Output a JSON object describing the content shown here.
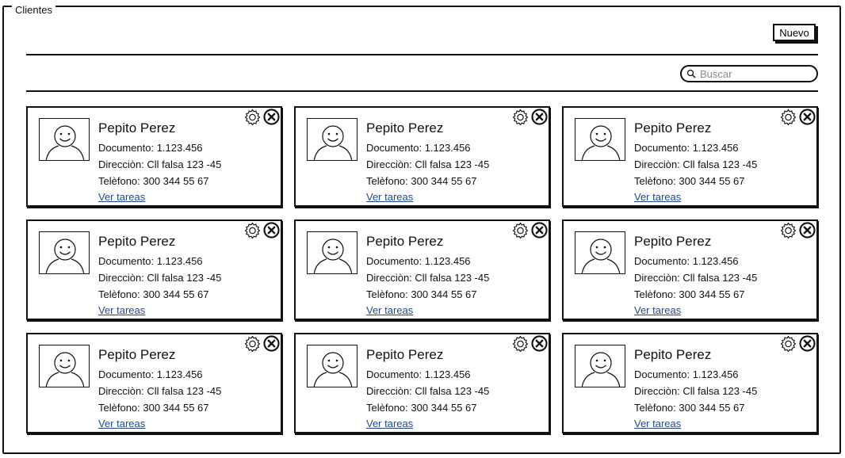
{
  "frame": {
    "title": "Clientes"
  },
  "toolbar": {
    "new_label": "Nuevo"
  },
  "search": {
    "placeholder": "Buscar",
    "icon": "search-icon"
  },
  "cards": [
    {
      "name": "Pepito Perez",
      "documento": "Documento: 1.123.456",
      "direccion": "Direcciòn: Cll falsa 123 -45",
      "telefono": "Telèfono: 300 344 55 67",
      "link": "Ver tareas"
    },
    {
      "name": "Pepito Perez",
      "documento": "Documento: 1.123.456",
      "direccion": "Direcciòn: Cll falsa 123 -45",
      "telefono": "Telèfono: 300 344 55 67",
      "link": "Ver tareas"
    },
    {
      "name": "Pepito Perez",
      "documento": "Documento: 1.123.456",
      "direccion": "Direcciòn: Cll falsa 123 -45",
      "telefono": "Telèfono: 300 344 55 67",
      "link": "Ver tareas"
    },
    {
      "name": "Pepito Perez",
      "documento": "Documento: 1.123.456",
      "direccion": "Direcciòn: Cll falsa 123 -45",
      "telefono": "Telèfono: 300 344 55 67",
      "link": "Ver tareas"
    },
    {
      "name": "Pepito Perez",
      "documento": "Documento: 1.123.456",
      "direccion": "Direcciòn: Cll falsa 123 -45",
      "telefono": "Telèfono: 300 344 55 67",
      "link": "Ver tareas"
    },
    {
      "name": "Pepito Perez",
      "documento": "Documento: 1.123.456",
      "direccion": "Direcciòn: Cll falsa 123 -45",
      "telefono": "Telèfono: 300 344 55 67",
      "link": "Ver tareas"
    },
    {
      "name": "Pepito Perez",
      "documento": "Documento: 1.123.456",
      "direccion": "Direcciòn: Cll falsa 123 -45",
      "telefono": "Telèfono: 300 344 55 67",
      "link": "Ver tareas"
    },
    {
      "name": "Pepito Perez",
      "documento": "Documento: 1.123.456",
      "direccion": "Direcciòn: Cll falsa 123 -45",
      "telefono": "Telèfono: 300 344 55 67",
      "link": "Ver tareas"
    },
    {
      "name": "Pepito Perez",
      "documento": "Documento: 1.123.456",
      "direccion": "Direcciòn: Cll falsa 123 -45",
      "telefono": "Telèfono: 300 344 55 67",
      "link": "Ver tareas"
    }
  ],
  "card_icons": {
    "settings": "gear-icon",
    "delete": "close-icon",
    "avatar": "avatar-icon"
  },
  "colors": {
    "ink": "#111111",
    "link": "#1f4a8a",
    "placeholder": "#888888"
  }
}
